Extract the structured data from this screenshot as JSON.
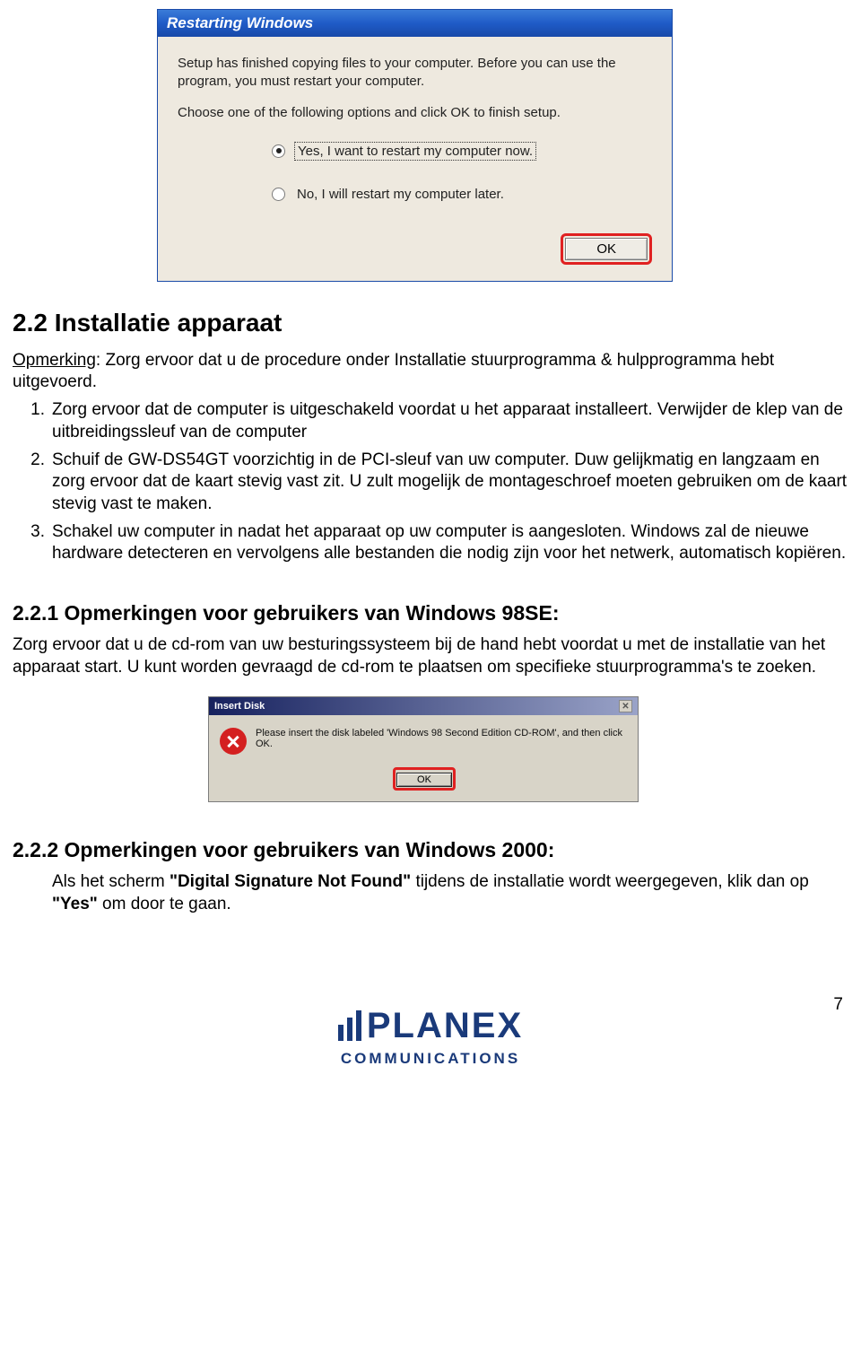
{
  "dialog1": {
    "title": "Restarting Windows",
    "line1": "Setup has finished copying files to your computer. Before you can use the program, you must restart your computer.",
    "line2": "Choose one of the following options and click OK to finish setup.",
    "option_yes": "Yes, I want to restart my computer now.",
    "option_no": "No, I will restart my computer later.",
    "ok": "OK"
  },
  "doc": {
    "h2": "2.2 Installatie apparaat",
    "note_label": "Opmerking",
    "note_body": ": Zorg ervoor dat u de procedure onder ",
    "note_bold": "Installatie stuurprogramma & hulpprogramma",
    "note_tail": " hebt uitgevoerd.",
    "item1": "Zorg ervoor dat de computer is uitgeschakeld voordat u het apparaat installeert. Verwijder de klep van de uitbreidingssleuf van de computer",
    "item2": "Schuif de GW-DS54GT voorzichtig in de PCI-sleuf van uw computer. Duw gelijkmatig en langzaam en zorg ervoor dat de kaart stevig vast zit. U zult mogelijk de montageschroef moeten gebruiken om de kaart stevig vast te maken.",
    "item3": "Schakel uw computer in nadat het apparaat op uw computer is aangesloten. Windows zal de nieuwe hardware detecteren en vervolgens alle bestanden die nodig zijn voor het netwerk, automatisch kopiëren.",
    "h3a": "2.2.1 Opmerkingen voor gebruikers van Windows 98SE:",
    "p98": "Zorg ervoor dat u de cd-rom van uw besturingssysteem bij de hand hebt voordat u met de installatie van het apparaat start. U kunt worden gevraagd de cd-rom te plaatsen om specifieke stuurprogramma's te zoeken.",
    "h3b": "2.2.2 Opmerkingen voor gebruikers van Windows 2000:",
    "p2000_a": "Als het scherm ",
    "p2000_bold1": "\"Digital Signature Not Found\"",
    "p2000_b": " tijdens de installatie wordt weergegeven, klik dan op ",
    "p2000_bold2": "\"Yes\"",
    "p2000_c": " om door te gaan."
  },
  "dialog2": {
    "title": "Insert Disk",
    "msg": "Please insert the disk labeled 'Windows 98 Second Edition CD-ROM', and then click OK.",
    "ok": "OK"
  },
  "footer": {
    "brand": "PLANEX",
    "sub": "COMMUNICATIONS",
    "page": "7"
  }
}
